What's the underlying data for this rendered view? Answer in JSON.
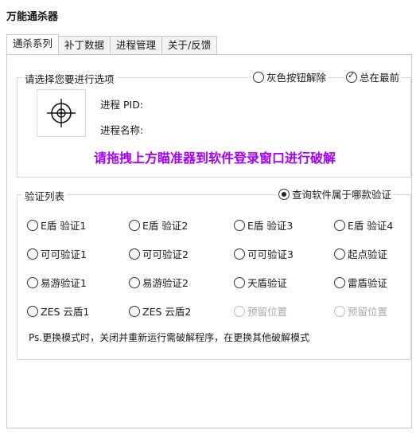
{
  "window": {
    "title": "万能通杀器"
  },
  "tabs": [
    {
      "label": "通杀系列",
      "active": true
    },
    {
      "label": "补丁数据",
      "active": false
    },
    {
      "label": "进程管理",
      "active": false
    },
    {
      "label": "关于/反馈",
      "active": false
    }
  ],
  "options": {
    "group_label": "请选择您要进行选项",
    "gray_button_release": {
      "label": "灰色按钮解除",
      "checked": false
    },
    "always_on_top": {
      "label": "总在最前",
      "checked": true
    },
    "process_pid_label": "进程 PID:",
    "process_name_label": "进程名称:",
    "instruction": "请拖拽上方瞄准器到软件登录窗口进行破解",
    "instruction_color": "#a500ff"
  },
  "verify": {
    "group_label": "验证列表",
    "query_option": {
      "label": "查询软件属于哪款验证",
      "checked": true
    },
    "items": [
      {
        "label": "E盾 验证1",
        "disabled": false
      },
      {
        "label": "E盾 验证2",
        "disabled": false
      },
      {
        "label": "E盾 验证3",
        "disabled": false
      },
      {
        "label": "E盾 验证4",
        "disabled": false
      },
      {
        "label": "可可验证1",
        "disabled": false
      },
      {
        "label": "可可验证2",
        "disabled": false
      },
      {
        "label": "可可验证3",
        "disabled": false
      },
      {
        "label": "起点验证",
        "disabled": false
      },
      {
        "label": "易游验证1",
        "disabled": false
      },
      {
        "label": "易游验证2",
        "disabled": false
      },
      {
        "label": "天盾验证",
        "disabled": false
      },
      {
        "label": "雷盾验证",
        "disabled": false
      },
      {
        "label": "ZES 云盾1",
        "disabled": false
      },
      {
        "label": "ZES 云盾2",
        "disabled": false
      },
      {
        "label": "预留位置",
        "disabled": true
      },
      {
        "label": "预留位置",
        "disabled": true
      }
    ],
    "note": "Ps.更换模式时，关闭并重新运行需破解程序，在更换其他破解模式"
  },
  "icons": {
    "crosshair": "crosshair-icon"
  }
}
